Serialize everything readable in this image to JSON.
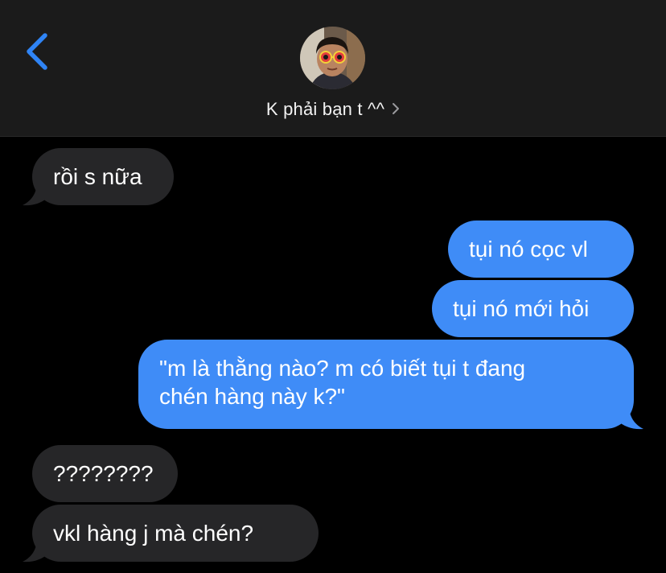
{
  "header": {
    "back_icon": "chevron-left-icon",
    "contact_name": "K phải bạn t ^^",
    "contact_chevron_icon": "chevron-right-icon",
    "avatar_icon": "contact-photo"
  },
  "messages": [
    {
      "direction": "received",
      "text": "rồi s nữa"
    },
    {
      "direction": "sent",
      "text": "tụi nó cọc vl"
    },
    {
      "direction": "sent",
      "text": "tụi nó mới hỏi"
    },
    {
      "direction": "sent",
      "lines": [
        "\"m là thằng nào? m có biết tụi t đang",
        "chén hàng này k?\""
      ]
    },
    {
      "direction": "received",
      "text": "????????"
    },
    {
      "direction": "received",
      "text": "vkl hàng j mà chén?"
    }
  ],
  "colors": {
    "background": "#000000",
    "header": "#1b1b1b",
    "sent_bubble": "#3f8cf7",
    "received_bubble": "#262628",
    "accent": "#2f84f5"
  }
}
